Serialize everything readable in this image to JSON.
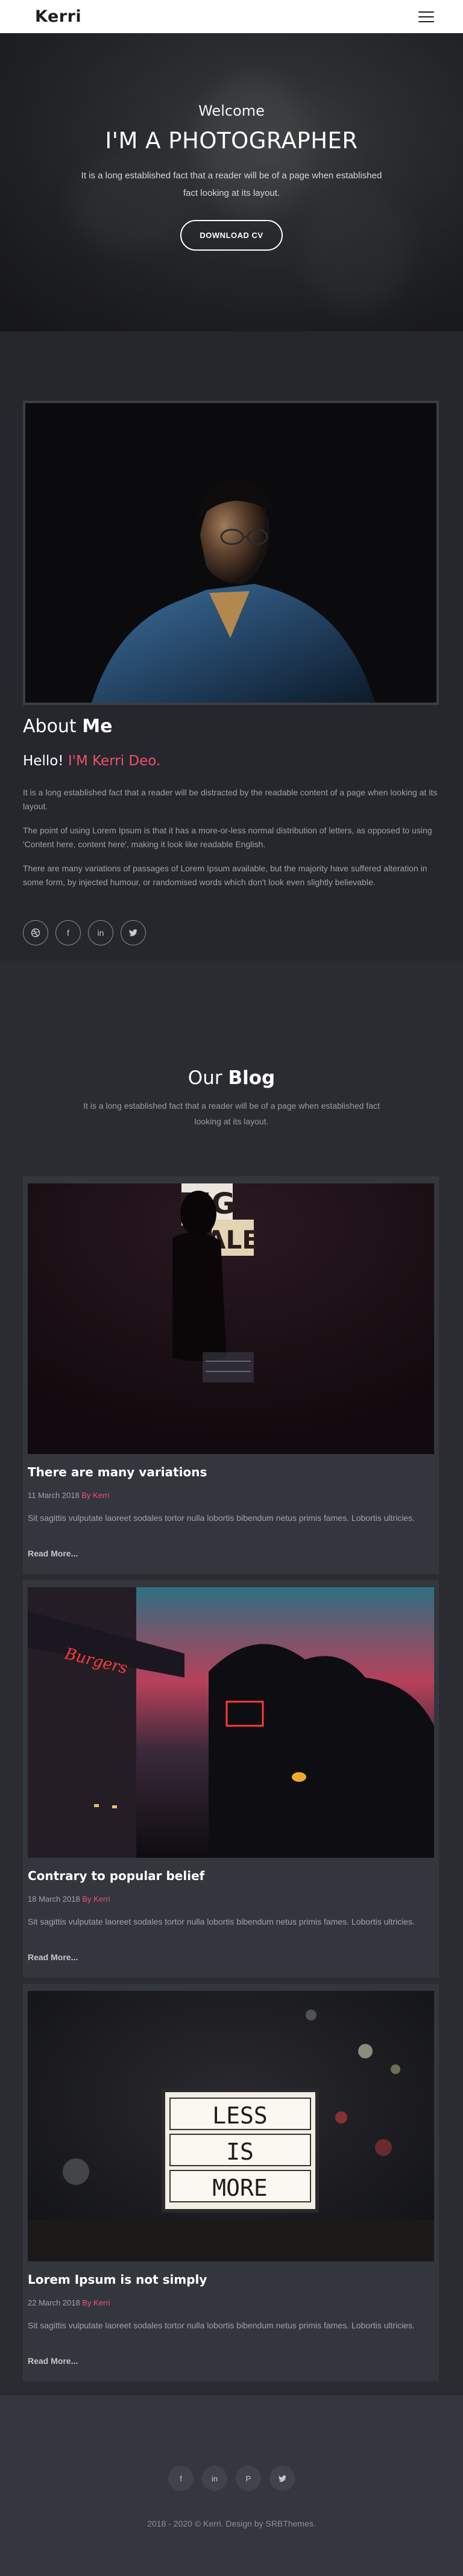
{
  "navbar": {
    "brand": "Kerri",
    "menu_icon": "hamburger-menu-icon"
  },
  "hero": {
    "welcome": "Welcome",
    "title": "I'M A PHOTOGRAPHER",
    "text": "It is a long established fact that a reader will be of a page when established fact looking at its layout.",
    "button": "DOWNLOAD CV"
  },
  "about": {
    "heading_light": "About",
    "heading_bold": "Me",
    "hello": "Hello!",
    "name": "I'M Kerri Deo.",
    "paragraphs": [
      "It is a long established fact that a reader will be distracted by the readable content of a page when looking at its layout.",
      "The point of using Lorem Ipsum is that it has a more-or-less normal distribution of letters, as opposed to using 'Content here, content here', making it look like readable English.",
      "There are many variations of passages of Lorem Ipsum available, but the majority have suffered alteration in some form, by injected humour, or randomised words which don't look even slightly believable."
    ],
    "social": [
      {
        "icon": "dribbble-icon",
        "glyph": ""
      },
      {
        "icon": "facebook-icon",
        "glyph": "f"
      },
      {
        "icon": "linkedin-icon",
        "glyph": "in"
      },
      {
        "icon": "twitter-icon",
        "glyph": ""
      }
    ]
  },
  "blog": {
    "title_light": "Our",
    "title_bold": "Blog",
    "subtitle": "It is a long established fact that a reader will be of a page when established fact looking at its layout.",
    "posts": [
      {
        "title": "There are many variations",
        "date": "11 March 2018",
        "author": "By Kerri",
        "text": "Sit sagittis vulputate laoreet sodales tortor nulla lobortis bibendum netus primis fames. Lobortis ultricies.",
        "more": "Read More..."
      },
      {
        "title": "Contrary to popular belief",
        "date": "18 March 2018",
        "author": "By Kerri",
        "text": "Sit sagittis vulputate laoreet sodales tortor nulla lobortis bibendum netus primis fames. Lobortis ultricies.",
        "more": "Read More..."
      },
      {
        "title": "Lorem Ipsum is not simply",
        "date": "22 March 2018",
        "author": "By Kerri",
        "text": "Sit sagittis vulputate laoreet sodales tortor nulla lobortis bibendum netus primis fames. Lobortis ultricies.",
        "more": "Read More..."
      }
    ],
    "images": {
      "sign1": "BIG",
      "sign2": "ALE",
      "neon": "Burgers",
      "less1": "LESS",
      "less2": "IS",
      "less3": "MORE"
    }
  },
  "footer": {
    "social": [
      {
        "icon": "facebook-icon",
        "glyph": "f"
      },
      {
        "icon": "linkedin-icon",
        "glyph": "in"
      },
      {
        "icon": "pinterest-icon",
        "glyph": "P"
      },
      {
        "icon": "twitter-icon",
        "glyph": ""
      }
    ],
    "copyright": "2018 - 2020 © Kerri. Design by SRBThemes."
  },
  "colors": {
    "accent": "#f0506e",
    "background": "#25272d",
    "card": "#33363d"
  }
}
